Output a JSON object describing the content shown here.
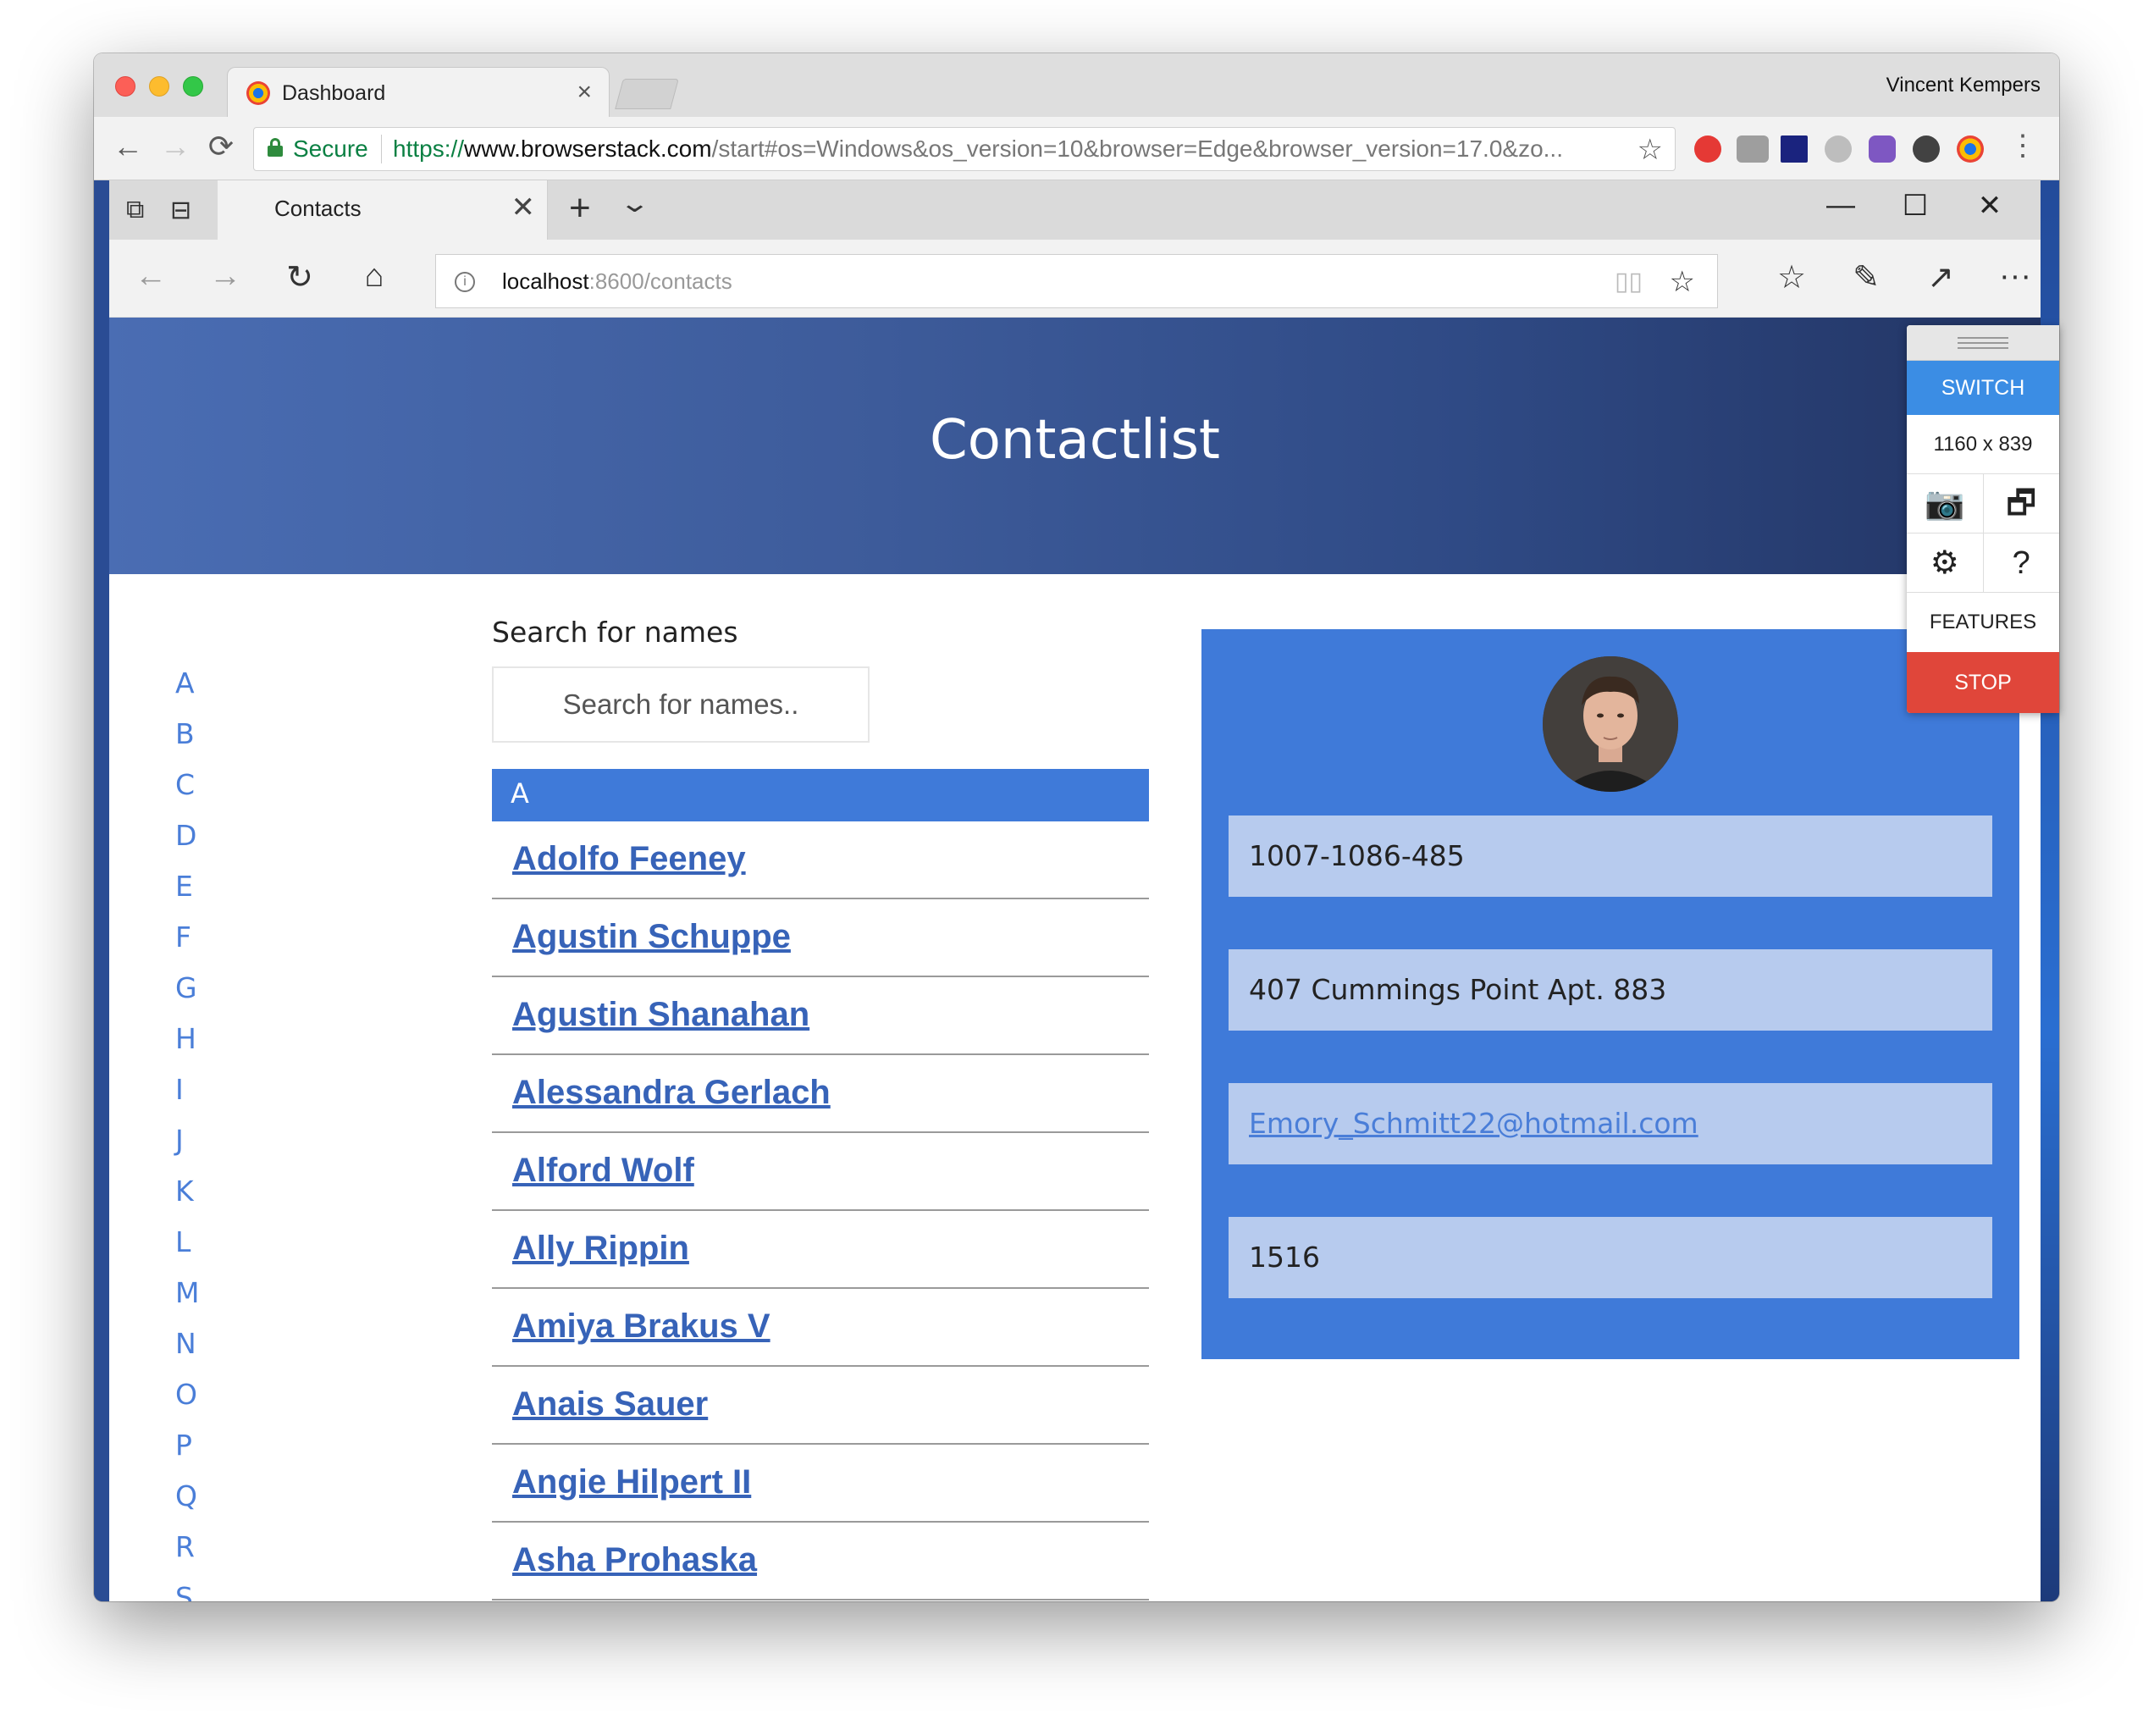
{
  "mac_chrome": {
    "tab_title": "Dashboard",
    "tab_close": "×",
    "user_name": "Vincent Kempers",
    "secure_label": "Secure",
    "url_scheme": "https://",
    "url_host": "www.browserstack.com",
    "url_rest": "/start#os=Windows&os_version=10&browser=Edge&browser_version=17.0&zo...",
    "back_icon": "←",
    "forward_icon": "→",
    "reload_icon": "⟳",
    "star_icon": "☆",
    "menu_icon": "⋮"
  },
  "edge": {
    "tab_title": "Contacts",
    "tab_close": "✕",
    "new_tab": "+",
    "tab_list": "⌄",
    "minimize": "—",
    "maximize": "☐",
    "close": "✕",
    "back_icon": "←",
    "forward_icon": "→",
    "refresh_icon": "↻",
    "home_icon": "⌂",
    "address_host": "localhost",
    "address_rest": ":8600/contacts",
    "info_icon": "i",
    "reading_icon": "📖",
    "favorite_icon": "☆",
    "favorites_hub_icon": "☆≡",
    "notes_icon": "✎",
    "share_icon": "↗",
    "more_icon": "···"
  },
  "page": {
    "title": "Contactlist",
    "alphabet": [
      "A",
      "B",
      "C",
      "D",
      "E",
      "F",
      "G",
      "H",
      "I",
      "J",
      "K",
      "L",
      "M",
      "N",
      "O",
      "P",
      "Q",
      "R",
      "S"
    ],
    "search_label": "Search for names",
    "search_placeholder": "Search for names..",
    "group_letter": "A",
    "contacts": [
      "Adolfo Feeney",
      "Agustin Schuppe",
      "Agustin Shanahan",
      "Alessandra Gerlach",
      "Alford Wolf",
      "Ally Rippin",
      "Amiya Brakus V",
      "Anais Sauer",
      "Angie Hilpert II",
      "Asha Prohaska"
    ],
    "detail": {
      "phone": "1007-1086-485",
      "address": "407 Cummings Point Apt. 883",
      "email": "Emory_Schmitt22@hotmail.com",
      "number": "1516"
    }
  },
  "browserstack": {
    "switch_label": "SWITCH",
    "resolution": "1160 x 839",
    "camera_icon": "📷",
    "windows_icon": "🗗",
    "settings_icon": "⚙",
    "help_icon": "?",
    "features_label": "FEATURES",
    "stop_label": "STOP"
  }
}
